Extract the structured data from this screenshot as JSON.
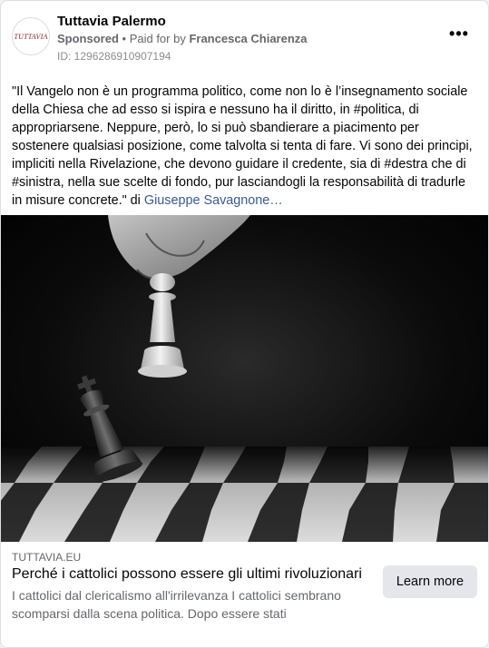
{
  "post": {
    "page_name": "Tuttavia Palermo",
    "avatar_text": "TUTTAVIA",
    "sponsored_label": "Sponsored",
    "separator": " • ",
    "paid_for_prefix": "Paid for by ",
    "paid_for_name": "Francesca Chiarenza",
    "ad_id": "ID: 1296286910907194",
    "more_icon": "more-horizontal-icon",
    "more_glyph": "•••",
    "body": "\"Il Vangelo non è un programma politico, come non lo è l’insegnamento sociale della Chiesa che ad esso si ispira e nessuno ha il diritto, in #politica, di appropriarsene. Neppure, però, lo si può sbandierare a piacimento per sostenere qualsiasi posizione, come talvolta si tenta di fare. Vi sono dei principi, impliciti nella Rivelazione, che devono guidare il credente, sia di #destra che di #sinistra, nella sue scelte di fondo, pur lasciandogli la responsabilità di tradurle in misure concrete.\" di ",
    "author": "Giuseppe Savagnone…"
  },
  "link": {
    "domain": "TUTTAVIA.EU",
    "title": "Perché i cattolici possono essere gli ultimi rivoluzionari",
    "description": "I cattolici dal clericalismo all'irrilevanza I cattolici sembrano scomparsi dalla scena politica. Dopo essere stati",
    "cta_label": "Learn more"
  },
  "colors": {
    "link_blue": "#385898",
    "secondary_text": "#65676b",
    "button_bg": "#e4e6eb"
  }
}
